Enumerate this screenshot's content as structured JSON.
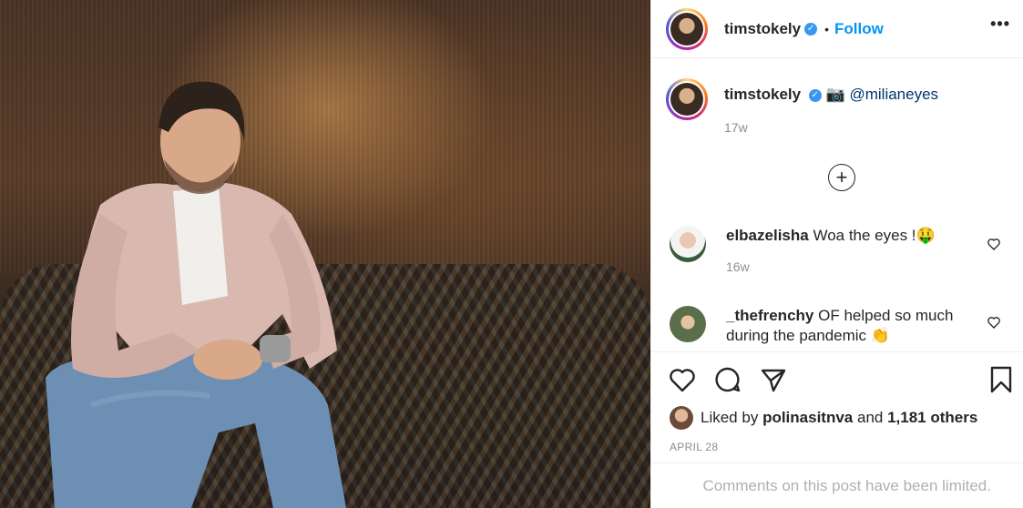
{
  "post": {
    "username": "timstokely",
    "verified_badge": "✓",
    "separator": "•",
    "follow_label": "Follow",
    "more_icon": "•••",
    "caption": {
      "username": "timstokely",
      "camera_emoji": "📷",
      "mention": "@milianeyes",
      "time": "17w"
    },
    "load_more_icon": "+",
    "comments": [
      {
        "username": "elbazelisha",
        "text": "Woa the eyes !",
        "emoji": "🤑",
        "time": "16w"
      },
      {
        "username": "_thefrenchy",
        "text": "OF helped so much during the pandemic",
        "emoji": "👏"
      }
    ],
    "likes": {
      "prefix": "Liked by",
      "user": "polinasitnva",
      "middle": "and",
      "count": "1,181 others"
    },
    "date": "APRIL 28",
    "limited_notice": "Comments on this post have been limited.",
    "accent_color": "#0095f6"
  }
}
